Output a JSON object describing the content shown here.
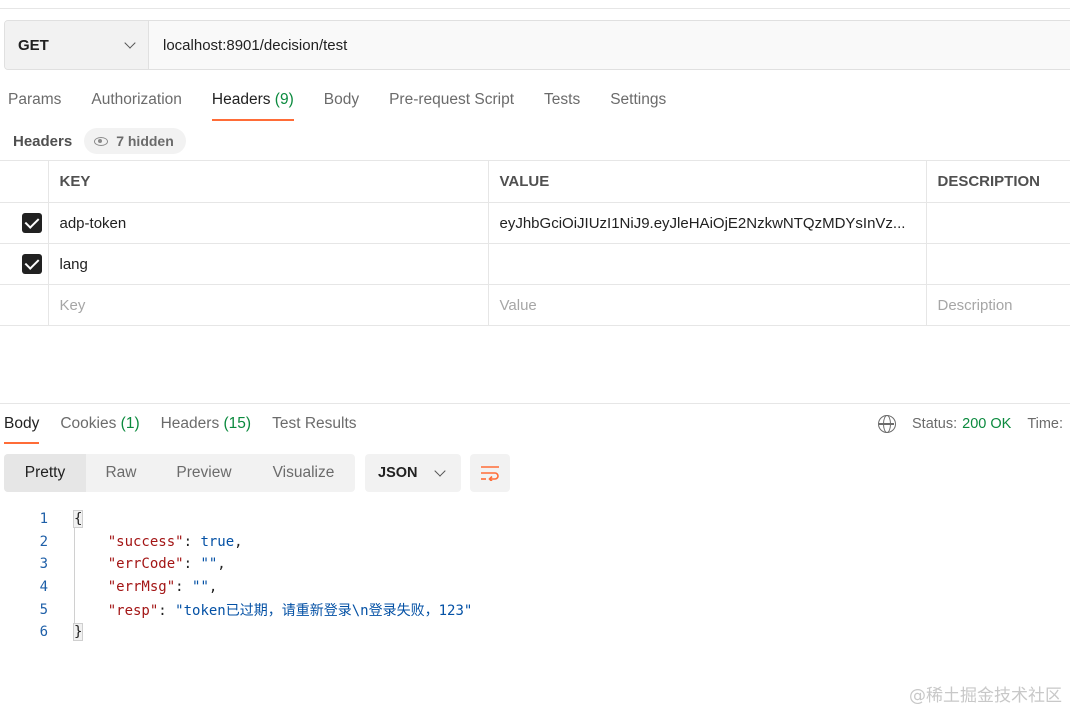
{
  "request": {
    "method": "GET",
    "url": "localhost:8901/decision/test"
  },
  "request_tabs": [
    {
      "label": "Params"
    },
    {
      "label": "Authorization"
    },
    {
      "label": "Headers",
      "count": "(9)"
    },
    {
      "label": "Body"
    },
    {
      "label": "Pre-request Script"
    },
    {
      "label": "Tests"
    },
    {
      "label": "Settings"
    }
  ],
  "headers_section": {
    "title": "Headers",
    "hidden_label": "7 hidden"
  },
  "table": {
    "columns": [
      "KEY",
      "VALUE",
      "DESCRIPTION"
    ],
    "rows": [
      {
        "checked": true,
        "key": "adp-token",
        "value": "eyJhbGciOiJIUzI1NiJ9.eyJleHAiOjE2NzkwNTQzMDYsInVz...",
        "description": ""
      },
      {
        "checked": true,
        "key": "lang",
        "value": "",
        "description": ""
      }
    ],
    "placeholders": {
      "key": "Key",
      "value": "Value",
      "description": "Description"
    }
  },
  "response_tabs": [
    {
      "label": "Body"
    },
    {
      "label": "Cookies",
      "count": "(1)"
    },
    {
      "label": "Headers",
      "count": "(15)"
    },
    {
      "label": "Test Results"
    }
  ],
  "status": {
    "label": "Status:",
    "value": "200 OK",
    "time_label": "Time:"
  },
  "view_modes": [
    "Pretty",
    "Raw",
    "Preview",
    "Visualize"
  ],
  "format": "JSON",
  "code_lines": [
    {
      "n": "1"
    },
    {
      "n": "2",
      "key": "\"success\"",
      "val": "true",
      "tail": ","
    },
    {
      "n": "3",
      "key": "\"errCode\"",
      "val": "\"\"",
      "tail": ","
    },
    {
      "n": "4",
      "key": "\"errMsg\"",
      "val": "\"\"",
      "tail": ","
    },
    {
      "n": "5",
      "key": "\"resp\"",
      "val": "\"token已过期，请重新登录\\n登录失败，123\"",
      "tail": ""
    },
    {
      "n": "6"
    }
  ],
  "watermark": "@稀土掘金技术社区"
}
